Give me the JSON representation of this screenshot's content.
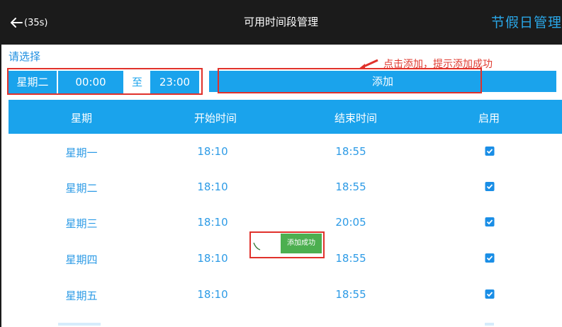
{
  "header": {
    "countdown": "(35s)",
    "title": "可用时间段管理",
    "holiday_button": "节假日管理"
  },
  "selector": {
    "label": "请选择",
    "weekday": "星期二",
    "start_time": "00:00",
    "separator": "至",
    "end_time": "23:00",
    "add_button": "添加"
  },
  "annotation": {
    "hint": "点击添加，提示添加成功"
  },
  "table": {
    "columns": [
      "星期",
      "开始时间",
      "结束时间",
      "启用"
    ],
    "rows": [
      {
        "day": "星期一",
        "start": "18:10",
        "end": "18:55",
        "enabled": true
      },
      {
        "day": "星期二",
        "start": "18:10",
        "end": "18:55",
        "enabled": true
      },
      {
        "day": "星期三",
        "start": "18:10",
        "end": "20:05",
        "enabled": true
      },
      {
        "day": "星期四",
        "start": "18:10",
        "end": "18:55",
        "enabled": true
      },
      {
        "day": "星期五",
        "start": "18:10",
        "end": "18:55",
        "enabled": true
      }
    ]
  },
  "toast": {
    "message": "添加成功"
  },
  "colors": {
    "topbar": "#1b1b1b",
    "accent": "#1aa3ec",
    "annotation_red": "#e0312b",
    "toast_green": "#4caf50"
  }
}
